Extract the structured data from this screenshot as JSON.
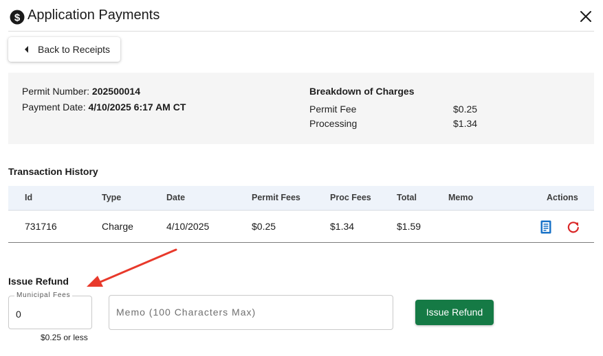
{
  "header": {
    "title": "Application Payments",
    "icon": "dollar-circle-icon",
    "close_icon": "close-icon"
  },
  "back_button": {
    "label": "Back to Receipts",
    "icon": "caret-left-icon"
  },
  "permit_info": {
    "permit_number_label": "Permit Number:",
    "permit_number": "202500014",
    "payment_date_label": "Payment Date:",
    "payment_date": "4/10/2025 6:17 AM CT"
  },
  "breakdown": {
    "title": "Breakdown of Charges",
    "rows": [
      {
        "label": "Permit Fee",
        "value": "$0.25"
      },
      {
        "label": "Processing",
        "value": "$1.34"
      }
    ]
  },
  "transaction_history": {
    "title": "Transaction History",
    "columns": [
      "Id",
      "Type",
      "Date",
      "Permit Fees",
      "Proc Fees",
      "Total",
      "Memo",
      "Actions"
    ],
    "rows": [
      {
        "id": "731716",
        "type": "Charge",
        "date": "4/10/2025",
        "permit_fees": "$0.25",
        "proc_fees": "$1.34",
        "total": "$1.59",
        "memo": ""
      }
    ]
  },
  "refund": {
    "title": "Issue Refund",
    "fees_label": "Municipal Fees",
    "fees_value": "0",
    "fees_hint": "$0.25 or less",
    "memo_placeholder": "Memo (100 Characters Max)",
    "button_label": "Issue Refund"
  },
  "colors": {
    "primary_button": "#157a45",
    "receipt_icon": "#1a73c8",
    "refresh_icon": "#d92626",
    "annotation_arrow": "#e8392b"
  }
}
